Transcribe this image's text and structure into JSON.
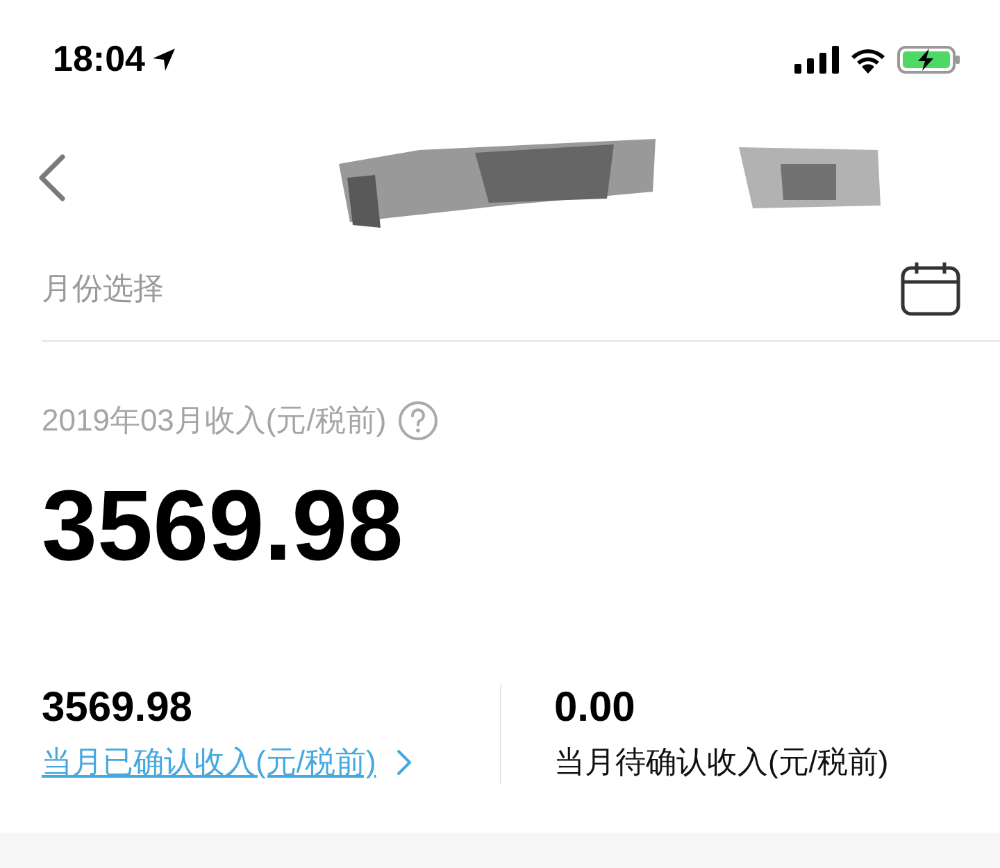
{
  "status_bar": {
    "time": "18:04",
    "battery_charging": true
  },
  "month_picker": {
    "label": "月份选择"
  },
  "income": {
    "title": "2019年03月收入(元/税前)",
    "amount": "3569.98"
  },
  "summary": [
    {
      "kind": "link",
      "value": "3569.98",
      "label": "当月已确认收入(元/税前)"
    },
    {
      "kind": "plain",
      "value": "0.00",
      "label": "当月待确认收入(元/税前)"
    }
  ]
}
